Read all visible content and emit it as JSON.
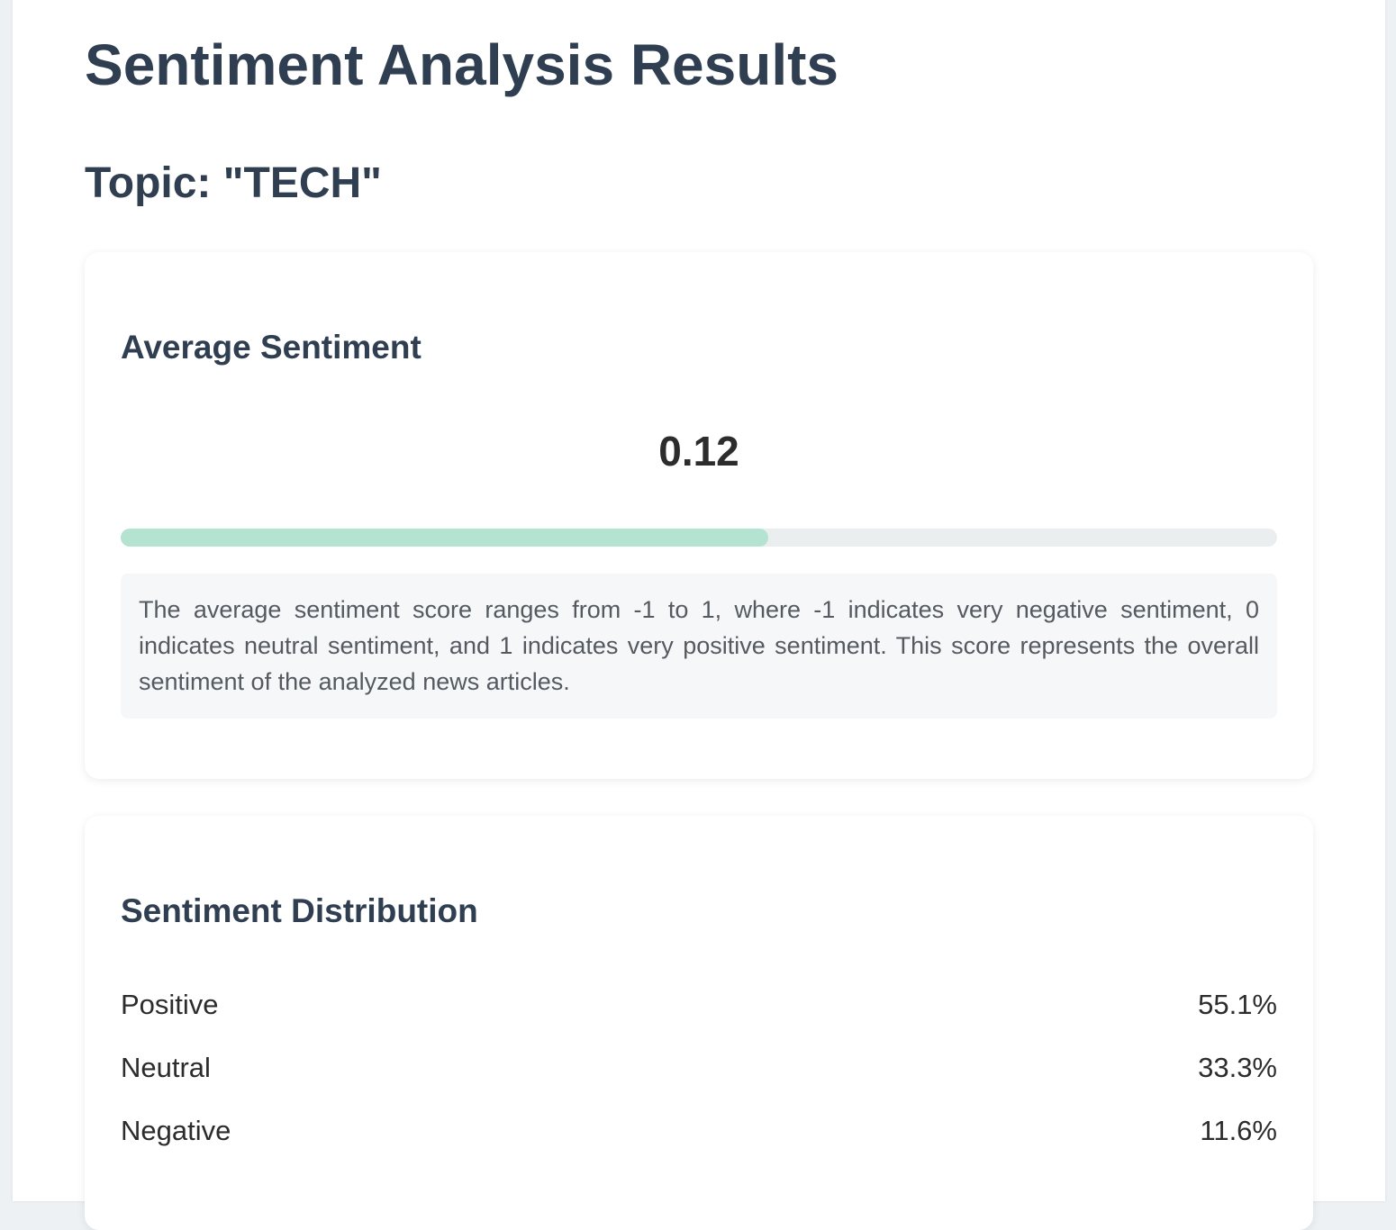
{
  "header": {
    "title": "Sentiment Analysis Results",
    "topic": "Topic: \"TECH\""
  },
  "average": {
    "title": "Average Sentiment",
    "score": "0.12",
    "score_fraction": 0.56,
    "bar_color": "#b5e3d1",
    "description": "The average sentiment score ranges from -1 to 1, where -1 indicates very negative sentiment, 0 indicates neutral sentiment, and 1 indicates very positive sentiment. This score represents the overall sentiment of the analyzed news articles."
  },
  "distribution": {
    "title": "Sentiment Distribution",
    "items": [
      {
        "label": "Positive",
        "value": "55.1%"
      },
      {
        "label": "Neutral",
        "value": "33.3%"
      },
      {
        "label": "Negative",
        "value": "11.6%"
      }
    ]
  }
}
